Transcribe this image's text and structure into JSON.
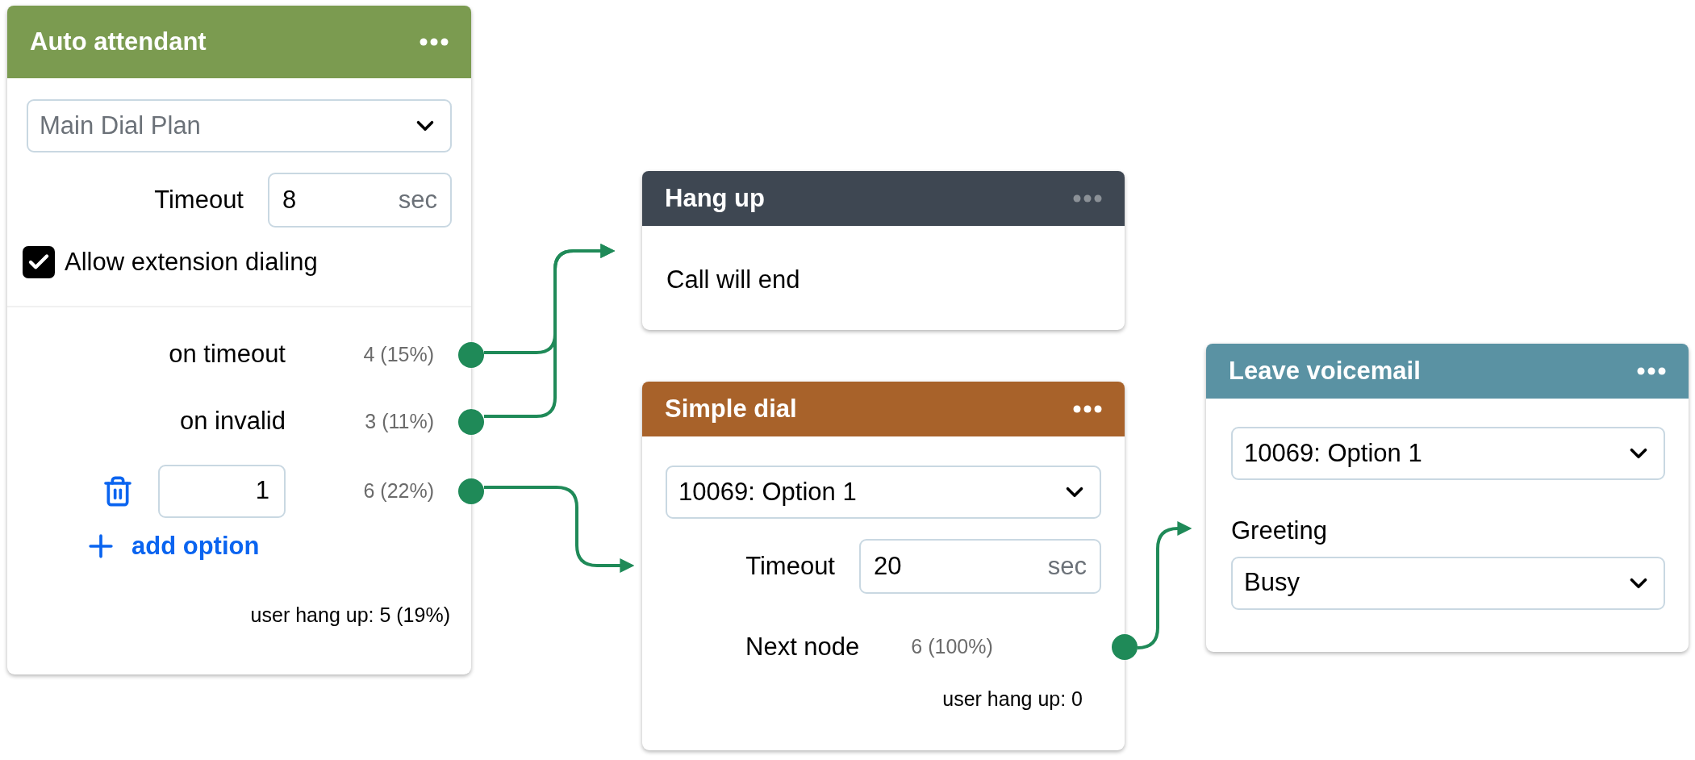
{
  "nodes": [
    {
      "kind": "auto_attendant",
      "title": "Auto attendant",
      "color": "#7b9b50",
      "menu_disabled": false,
      "dial_plan": "Main Dial Plan",
      "timeout_label": "Timeout",
      "timeout": "8",
      "unit": "sec",
      "extension_dialing": {
        "label": "Allow extension dialing",
        "checked": true
      },
      "outputs": [
        {
          "kind": "label",
          "label": "on timeout",
          "stat": "4 (15%)"
        },
        {
          "kind": "label",
          "label": "on invalid",
          "stat": "3 (11%)"
        },
        {
          "kind": "option",
          "value": "1",
          "stat": "6 (22%)"
        }
      ],
      "add_option": "add option",
      "hang_up": "user hang up: 5 (19%)"
    },
    {
      "kind": "hang_up",
      "title": "Hang up",
      "color": "#3e4752",
      "menu_disabled": true,
      "text": "Call will end"
    },
    {
      "kind": "simple_dial",
      "title": "Simple dial",
      "color": "#a8622a",
      "menu_disabled": false,
      "target": "10069: Option 1",
      "timeout_label": "Timeout",
      "timeout": "20",
      "unit": "sec",
      "next_label": "Next node",
      "next_stat": "6 (100%)",
      "hang_up": "user hang up: 0"
    },
    {
      "kind": "voicemail",
      "title": "Leave voicemail",
      "color": "#5a92a3",
      "menu_disabled": false,
      "mailbox": "10069: Option 1",
      "greeting_label": "Greeting",
      "greeting": "Busy"
    }
  ]
}
